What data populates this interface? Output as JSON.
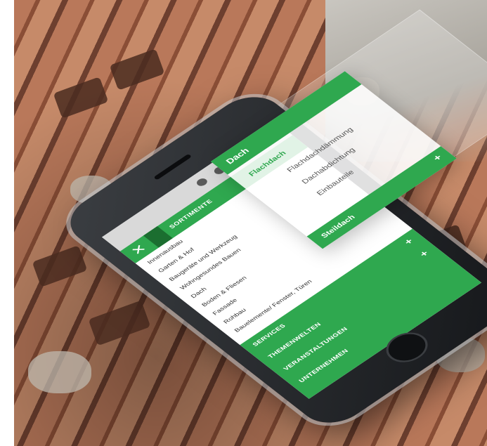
{
  "menu": {
    "title": "SORTIMENTE",
    "items": [
      "Innenausbau",
      "Garten & Hof",
      "Baugeräte und Werkzeug",
      "Wohngesundes Bauen",
      "Dach",
      "Boden & Fliesen",
      "Fassade",
      "Rohbau",
      "Bauelemente/ Fenster, Türen"
    ],
    "green_rows": [
      "SERVICES",
      "THEMENWELTEN",
      "VERANSTALTUNGEN",
      "UNTERNEHMEN"
    ]
  },
  "submenu": {
    "title": "Dach",
    "items": [
      "Flachdach",
      "Flachdachdämmung",
      "Dachabdichtung",
      "Einbauteile"
    ],
    "footer": "Steildach"
  },
  "colors": {
    "accent": "#2fa84f",
    "dark_green": "#1b6e30"
  }
}
